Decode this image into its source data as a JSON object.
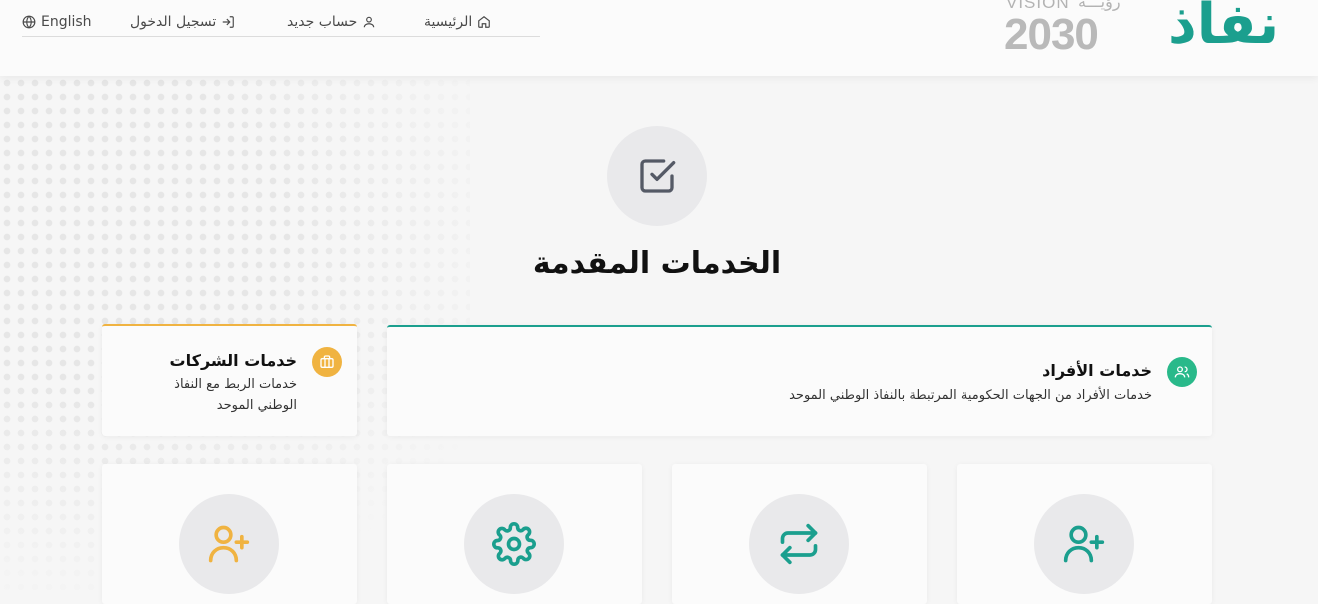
{
  "nav": {
    "language": "English",
    "login": "تسجيل الدخول",
    "register": "حساب جديد",
    "home": "الرئيسية"
  },
  "logos": {
    "vision_text": "VISION",
    "vision_arabic": "رؤيـــة",
    "vision_year": "2030",
    "nafath": "نفاذ"
  },
  "main": {
    "title": "الخدمات المقدمة",
    "cards": [
      {
        "title": "خدمات الأفراد",
        "description": "خدمات الأفراد من الجهات الحكومية المرتبطة بالنفاذ الوطني الموحد",
        "icon": "users-icon",
        "accent": "#1b9f8e"
      },
      {
        "title": "خدمات الشركات",
        "description": "خدمات الربط مع النفاذ الوطني الموحد",
        "icon": "briefcase-icon",
        "accent": "#f0b341"
      }
    ],
    "tiles": [
      {
        "icon": "add-user-icon",
        "color": "#1b9f8e"
      },
      {
        "icon": "transfer-arrows-icon",
        "color": "#1b9f8e"
      },
      {
        "icon": "gear-icon",
        "color": "#1b9f8e"
      },
      {
        "icon": "add-user-icon",
        "color": "#f0b341"
      }
    ]
  },
  "colors": {
    "primary": "#1b9f8e",
    "secondary": "#f0b341",
    "background": "#f6f6f6"
  }
}
